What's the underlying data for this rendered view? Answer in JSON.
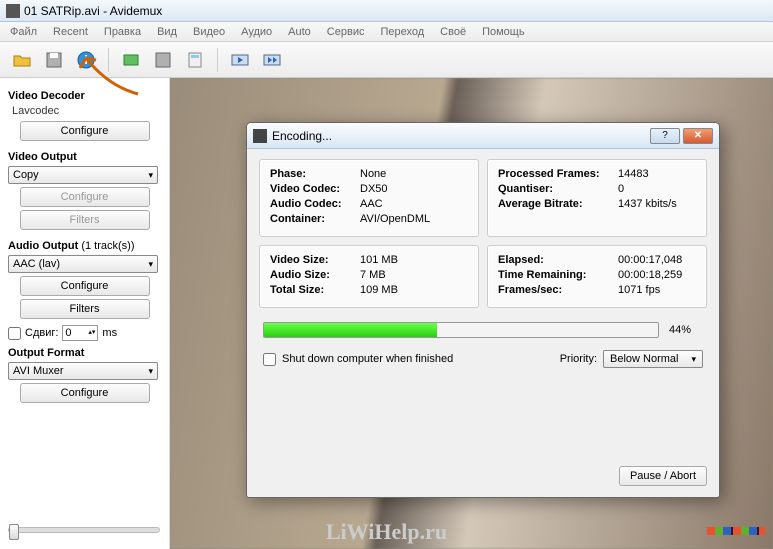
{
  "window": {
    "title": "01 SATRip.avi - Avidemux"
  },
  "menu": [
    "Файл",
    "Recent",
    "Правка",
    "Вид",
    "Видео",
    "Аудио",
    "Auto",
    "Сервис",
    "Переход",
    "Своё",
    "Помощь"
  ],
  "sidebar": {
    "video_decoder": {
      "head": "Video Decoder",
      "codec": "Lavcodec",
      "configure": "Configure"
    },
    "video_output": {
      "head": "Video Output",
      "value": "Copy",
      "configure": "Configure",
      "filters": "Filters"
    },
    "audio_output": {
      "head": "Audio Output",
      "tracks": "(1 track(s))",
      "value": "AAC (lav)",
      "configure": "Configure",
      "filters": "Filters",
      "shift_label": "Сдвиг:",
      "shift_value": "0",
      "shift_unit": "ms"
    },
    "output_format": {
      "head": "Output Format",
      "value": "AVI Muxer",
      "configure": "Configure"
    }
  },
  "dialog": {
    "title": "Encoding...",
    "left1": [
      {
        "label": "Phase:",
        "value": "None"
      },
      {
        "label": "Video Codec:",
        "value": "DX50"
      },
      {
        "label": "Audio Codec:",
        "value": "AAC"
      },
      {
        "label": "Container:",
        "value": "AVI/OpenDML"
      }
    ],
    "right1": [
      {
        "label": "Processed Frames:",
        "value": "14483"
      },
      {
        "label": "Quantiser:",
        "value": "0"
      },
      {
        "label": "Average Bitrate:",
        "value": "1437 kbits/s"
      }
    ],
    "left2": [
      {
        "label": "Video Size:",
        "value": "101 MB"
      },
      {
        "label": "Audio Size:",
        "value": "7 MB"
      },
      {
        "label": "Total Size:",
        "value": "109 MB"
      }
    ],
    "right2": [
      {
        "label": "Elapsed:",
        "value": "00:00:17,048"
      },
      {
        "label": "Time Remaining:",
        "value": "00:00:18,259"
      },
      {
        "label": "Frames/sec:",
        "value": "1071 fps"
      }
    ],
    "progress_pct": "44%",
    "shutdown": "Shut down computer when finished",
    "priority_label": "Priority:",
    "priority_value": "Below Normal",
    "pause_abort": "Pause / Abort"
  },
  "watermark": "LiWiHelp.ru"
}
